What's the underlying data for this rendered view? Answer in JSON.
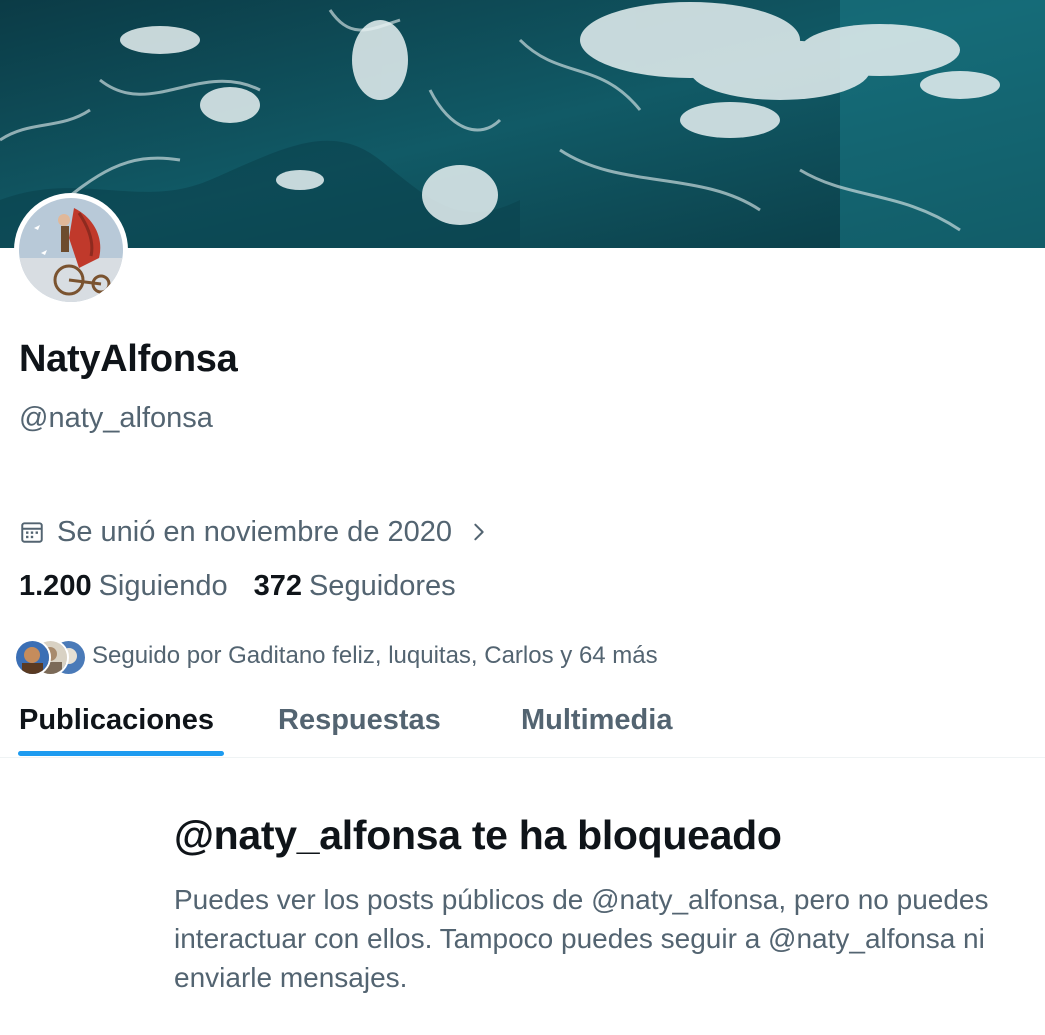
{
  "profile": {
    "display_name": "NatyAlfonsa",
    "handle": "@naty_alfonsa",
    "joined": "Se unió en noviembre de 2020",
    "following_count": "1.200",
    "following_label": "Siguiendo",
    "followers_count": "372",
    "followers_label": "Seguidores",
    "followed_by": "Seguido por Gaditano feliz, luquitas, Carlos y 64 más"
  },
  "tabs": [
    {
      "label": "Publicaciones",
      "active": true
    },
    {
      "label": "Respuestas",
      "active": false
    },
    {
      "label": "Multimedia",
      "active": false
    }
  ],
  "blocked": {
    "title": "@naty_alfonsa te ha bloqueado",
    "message": "Puedes ver los posts públicos de @naty_alfonsa, pero no puedes interactuar con ellos. Tampoco puedes seguir a @naty_alfonsa ni enviarle mensajes."
  },
  "colors": {
    "accent": "#1d9bf0",
    "text_primary": "#0f1419",
    "text_secondary": "#536471"
  },
  "icons": [
    "calendar-icon",
    "chevron-right-icon"
  ]
}
